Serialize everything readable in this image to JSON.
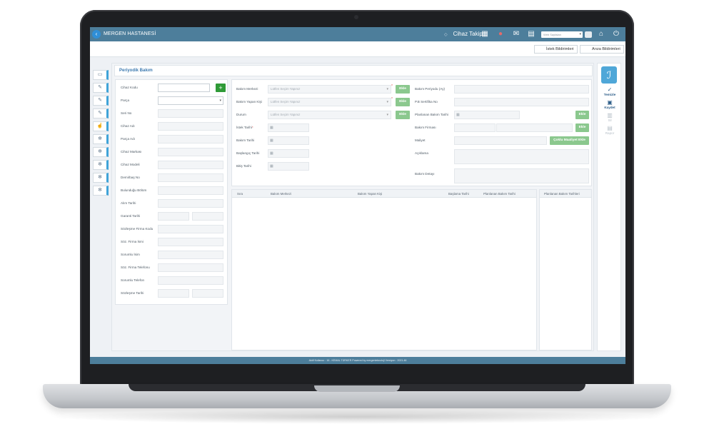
{
  "app": {
    "hospital_name": "MERGEN HASTANESİ",
    "module": "Cihaz Takip",
    "search_placeholder": "Web Sayfaları"
  },
  "subbar": {
    "request_button": "İstek Bildirimleri",
    "fault_button": "Arıza Bildirimleri"
  },
  "section_title": "Periyodik Bakım",
  "left_form": {
    "fields": [
      {
        "label": "Cihaz Kodu"
      },
      {
        "label": "Parça"
      },
      {
        "label": "Seri No"
      },
      {
        "label": "Cihaz Adı"
      },
      {
        "label": "Parça Adı"
      },
      {
        "label": "Cihaz Markası"
      },
      {
        "label": "Cihaz Modeli"
      },
      {
        "label": "Demirbaş No"
      },
      {
        "label": "Bulunduğu Bölüm"
      },
      {
        "label": "Alım Tarihi"
      },
      {
        "label": "Garanti Tarihi"
      },
      {
        "label": "Sözleşme Firma Kodu"
      },
      {
        "label": "Söz. Firma İsmi"
      },
      {
        "label": "Sorumlu İsim"
      },
      {
        "label": "Söz. Firma Telefonu"
      },
      {
        "label": "Sorumlu Telefon"
      },
      {
        "label": "Sözleşme Tarihi"
      }
    ],
    "add_button": "+"
  },
  "right_form": {
    "left_col": [
      {
        "label": "Bakım Merkezi",
        "placeholder": "Lütfen Seçim Yapınız",
        "button": "Ekle"
      },
      {
        "label": "Bakım Yapan Kişi",
        "placeholder": "Lütfen Seçim Yapınız",
        "button": "Ekle"
      },
      {
        "label": "Durum",
        "placeholder": "Lütfen Seçim Yapınız",
        "button": "Ekle"
      },
      {
        "label": "İstek Tarihi",
        "required": "*"
      },
      {
        "label": "Bakım Tarihi"
      },
      {
        "label": "Başlangıç Tarihi"
      },
      {
        "label": "Bitiş Tarihi"
      }
    ],
    "right_col": [
      {
        "label": "Bakım Periyodu (Ay)"
      },
      {
        "label": "P.B Sertifika No"
      },
      {
        "label": "Planlanan Bakım Tarihi",
        "button": "Ekle"
      },
      {
        "label": "Bakım Firması",
        "button": "Ekle"
      },
      {
        "label": "Maliyet",
        "button": "Çoklu Maaliyet Ekle"
      },
      {
        "label": "Açıklama"
      },
      {
        "label": "Bakım Detayı"
      }
    ]
  },
  "table": {
    "columns": [
      "Sıra",
      "Bakım Merkezi",
      "Bakım Yapan Kişi",
      "Başlama Tarihi",
      "Planlanan Bakım Tarihi"
    ],
    "side_column": "Planlanan Bakım Tarihleri"
  },
  "tools": {
    "clear": "Temizle",
    "save": "Kaydet",
    "delete": "Sil",
    "report": "Rapor"
  },
  "footer": {
    "text": "Aktif Kullanıcı : 16 - KEMAL TÜRKER    Powered by  mergenteknoloji    Versiyon : 2021.46"
  }
}
